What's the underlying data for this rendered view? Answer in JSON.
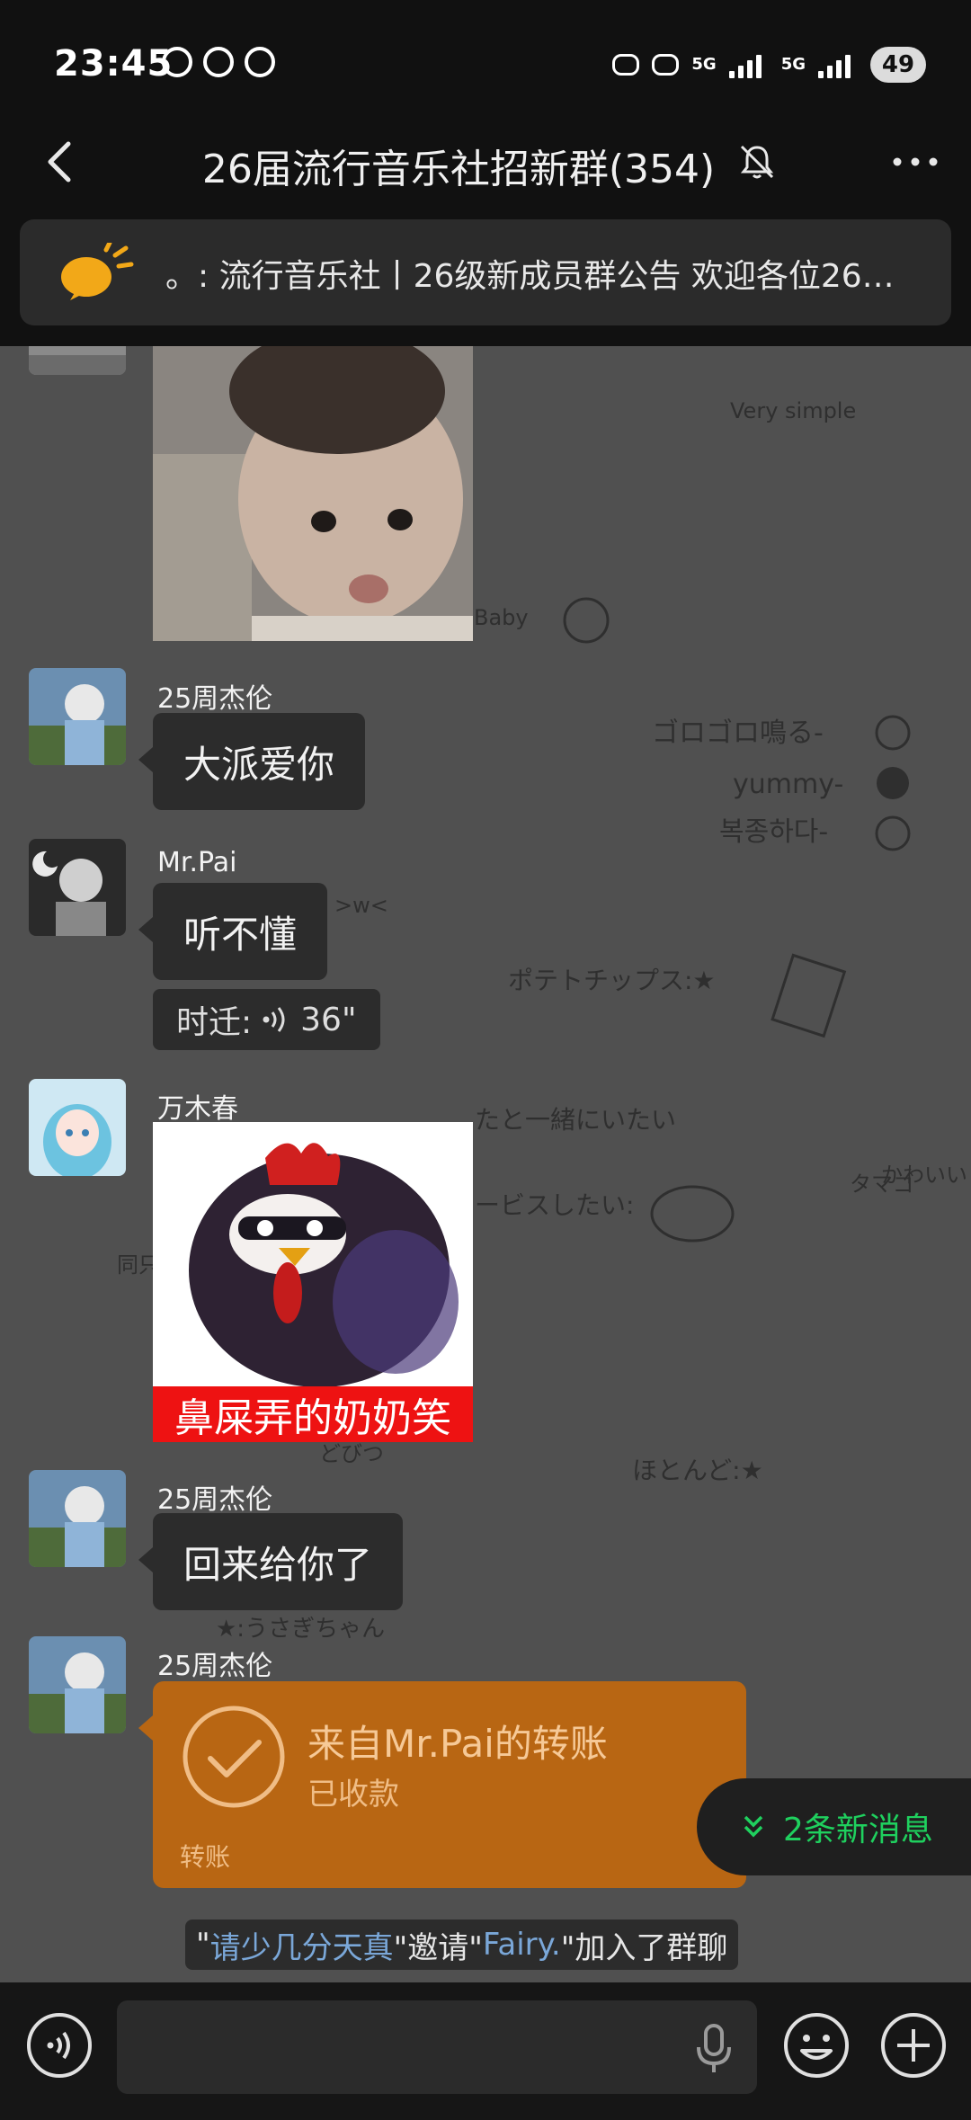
{
  "status_bar": {
    "time": "23:45",
    "battery": "49",
    "network_1": "5G",
    "network_2": "5G"
  },
  "header": {
    "title": "26届流行音乐社招新群(354)"
  },
  "notice": {
    "text": "。: 流行音乐社丨26级新成员群公告  欢迎各位26…"
  },
  "messages": [
    {
      "sender": "25周杰伦",
      "text": "大派爱你"
    },
    {
      "sender": "Mr.Pai",
      "text": "听不懂"
    },
    {
      "quote_label": "时迁:",
      "quote_duration": "36\""
    },
    {
      "sender": "万木春",
      "sticker_caption": "鼻屎弄的奶奶笑"
    },
    {
      "sender": "25周杰伦",
      "text": "回来给你了"
    },
    {
      "sender": "25周杰伦",
      "transfer_title": "来自Mr.Pai的转账",
      "transfer_status": "已收款",
      "transfer_type": "转账"
    }
  ],
  "new_messages": "2条新消息",
  "system_message": {
    "q1": "\"",
    "inviter": "请少几分天真",
    "mid": "\"邀请\"",
    "invitee": "Fairy.",
    "end": "\"加入了群聊"
  },
  "background_doodles": [
    "Very simple",
    "Baby",
    "ゴロゴロ鳴る-",
    "yummy-",
    "복종하다-",
    "ポテトチップス:★",
    ">w<",
    "たと一緒にいたい",
    "ービスしたい:",
    "かわいい",
    "タマゴ",
    "同只猫",
    "ほとんど:★",
    "★:うさぎちゃん",
    "どびつ"
  ],
  "colors": {
    "chat_bg": "#505050",
    "bubble": "#2c2c2c",
    "transfer": "#b86613",
    "new_msg": "#1fd05e",
    "link": "#7aa7d8"
  },
  "icons": [
    "back-icon",
    "mute-bell-icon",
    "more-icon",
    "notice-megaphone-icon",
    "voice-icon",
    "transfer-check-icon",
    "double-chevron-down-icon",
    "voice-input-icon",
    "mic-icon",
    "emoji-icon",
    "plus-icon"
  ]
}
